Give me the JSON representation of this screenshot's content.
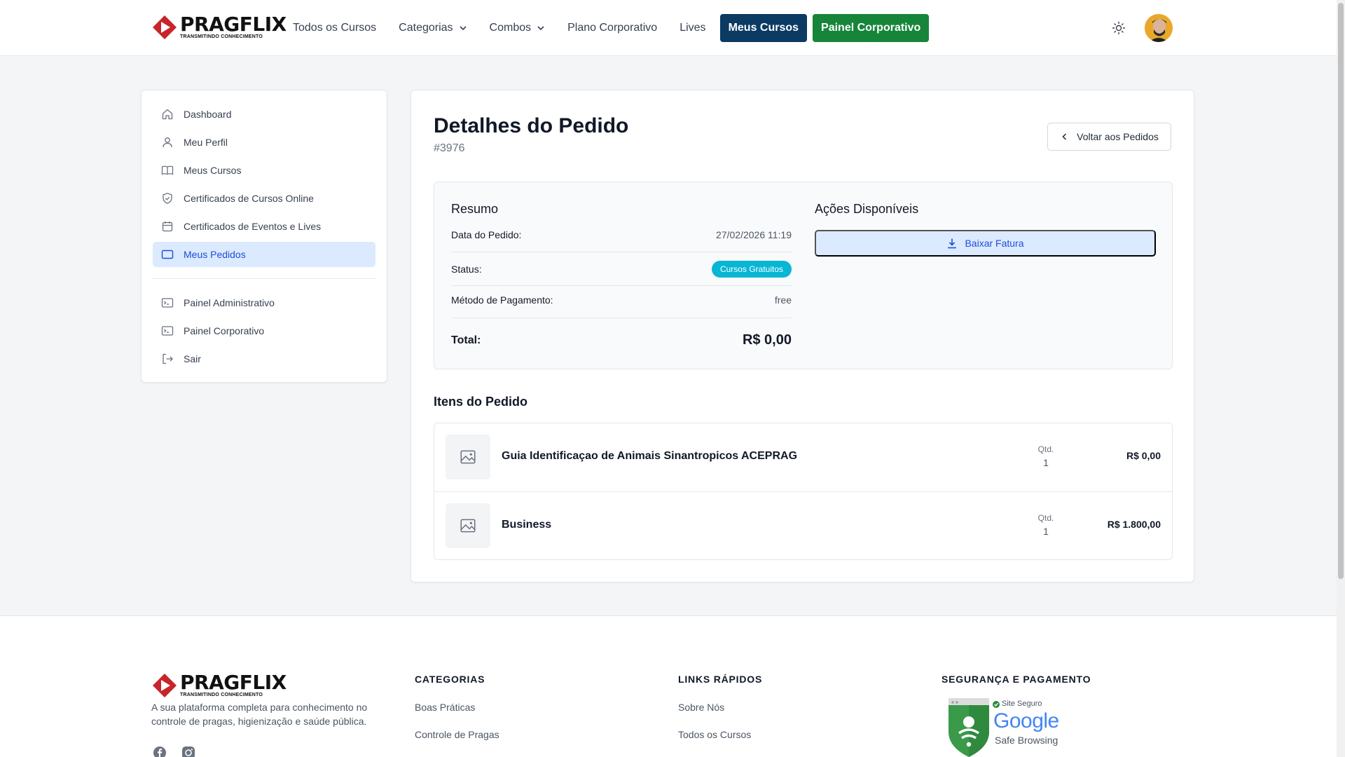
{
  "brand": {
    "name": "PRAGFLIX",
    "tagline": "TRANSMITINDO CONHECIMENTO",
    "red": "#c8242b"
  },
  "nav": {
    "items": [
      {
        "label": "Todos os Cursos"
      },
      {
        "label": "Categorias"
      },
      {
        "label": "Combos"
      },
      {
        "label": "Plano Corporativo"
      },
      {
        "label": "Lives"
      }
    ],
    "my_courses": "Meus Cursos",
    "corporate_panel": "Painel Corporativo",
    "accent_dark": "#0b3a63",
    "accent_green": "#16853a"
  },
  "sidebar": {
    "items": [
      {
        "label": "Dashboard",
        "icon": "home-icon"
      },
      {
        "label": "Meu Perfil",
        "icon": "user-icon"
      },
      {
        "label": "Meus Cursos",
        "icon": "book-icon"
      },
      {
        "label": "Certificados de Cursos Online",
        "icon": "shield-check-icon"
      },
      {
        "label": "Certificados de Eventos e Lives",
        "icon": "calendar-icon"
      },
      {
        "label": "Meus Pedidos",
        "icon": "card-icon",
        "active": true
      }
    ],
    "admin_items": [
      {
        "label": "Painel Administrativo",
        "icon": "terminal-icon"
      },
      {
        "label": "Painel Corporativo",
        "icon": "terminal-icon"
      },
      {
        "label": "Sair",
        "icon": "logout-icon"
      }
    ]
  },
  "order": {
    "title": "Detalhes do Pedido",
    "id": "#3976",
    "back_label": "Voltar aos Pedidos",
    "summary_title": "Resumo",
    "date_label": "Data do Pedido:",
    "date_value": "27/02/2026 11:19",
    "status_label": "Status:",
    "status_value": "Cursos Gratuitos",
    "payment_label": "Método de Pagamento:",
    "payment_value": "free",
    "total_label": "Total:",
    "total_value": "R$ 0,00",
    "actions_title": "Ações Disponíveis",
    "download_label": "Baixar Fatura",
    "items_title": "Itens do Pedido",
    "qty_label": "Qtd.",
    "items": [
      {
        "name": "Guia Identificaçao de Animais Sinantropicos ACEPRAG",
        "qty": "1",
        "price": "R$ 0,00"
      },
      {
        "name": "Business",
        "qty": "1",
        "price": "R$ 1.800,00"
      }
    ]
  },
  "footer": {
    "description": "A sua plataforma completa para conhecimento no controle de pragas, higienização e saúde pública.",
    "categories_title": "CATEGORIAS",
    "categories": [
      "Boas Práticas",
      "Controle de Pragas"
    ],
    "quick_links_title": "LINKS RÁPIDOS",
    "quick_links": [
      "Sobre Nós",
      "Todos os Cursos"
    ],
    "security_title": "SEGURANÇA E PAGAMENTO",
    "safe_badge": {
      "top": "Site Seguro",
      "brand": "Google",
      "sub": "Safe Browsing"
    }
  }
}
